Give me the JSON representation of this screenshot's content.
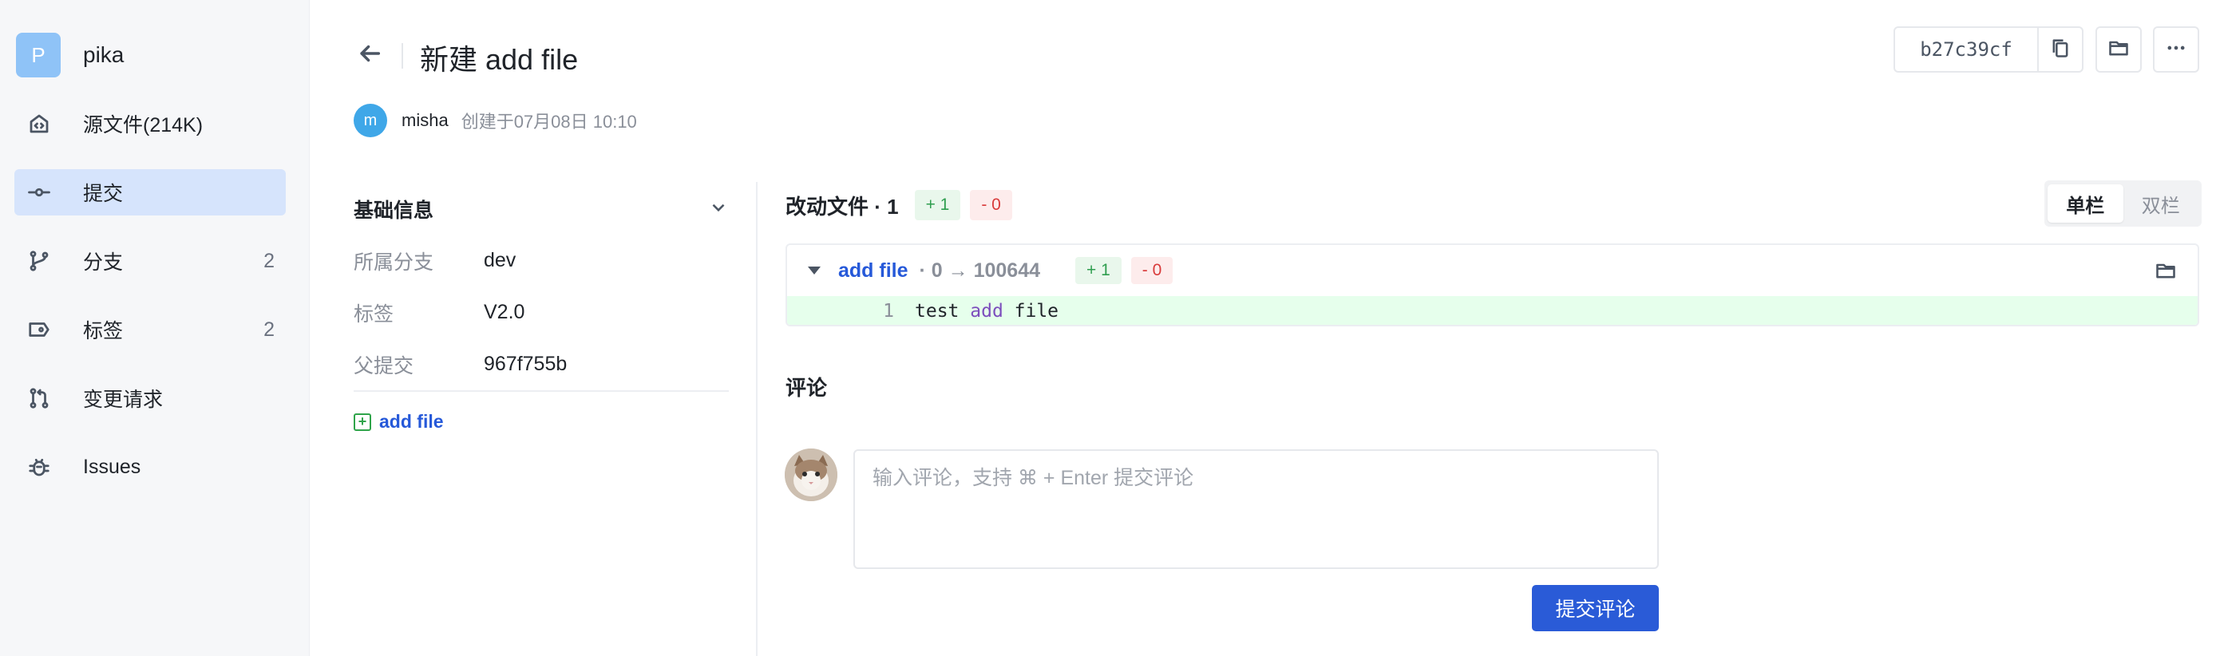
{
  "repo": {
    "avatar_letter": "P",
    "name": "pika"
  },
  "sidebar": {
    "items": [
      {
        "label": "源文件(214K)",
        "icon": "code-house-icon",
        "count": ""
      },
      {
        "label": "提交",
        "icon": "commit-icon",
        "count": "",
        "active": true
      },
      {
        "label": "分支",
        "icon": "branch-icon",
        "count": "2"
      },
      {
        "label": "标签",
        "icon": "tag-icon",
        "count": "2"
      },
      {
        "label": "变更请求",
        "icon": "pull-request-icon",
        "count": ""
      },
      {
        "label": "Issues",
        "icon": "bug-icon",
        "count": ""
      }
    ]
  },
  "header": {
    "title": "新建 add file",
    "author_initial": "m",
    "author": "misha",
    "created": "创建于07月08日 10:10",
    "commit_hash": "b27c39cf"
  },
  "info": {
    "title": "基础信息",
    "rows": [
      {
        "key": "所属分支",
        "value": "dev"
      },
      {
        "key": "标签",
        "value": "V2.0"
      },
      {
        "key": "父提交",
        "value": "967f755b"
      }
    ],
    "file_link": "add file"
  },
  "changes": {
    "title": "改动文件 · 1",
    "added": "+ 1",
    "removed": "- 0",
    "view_single": "单栏",
    "view_split": "双栏"
  },
  "diff": {
    "file": "add file",
    "meta": "· 0 → 100644",
    "added": "+ 1",
    "removed": "- 0",
    "line_number": "1",
    "code_pre": "test ",
    "code_kw": "add",
    "code_post": " file"
  },
  "comments": {
    "title": "评论",
    "placeholder": "输入评论，支持 ⌘ + Enter 提交评论",
    "submit": "提交评论"
  },
  "colors": {
    "accent": "#2a5bd7",
    "active_nav": "#d6e4fc",
    "added_bg": "#e6ffec",
    "add_badge": "#2f9e4f",
    "del_badge": "#d93b3b"
  }
}
